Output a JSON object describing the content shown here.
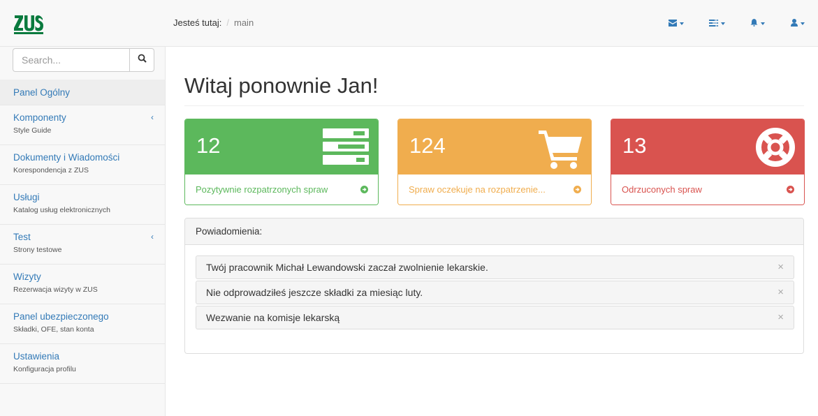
{
  "header": {
    "logo_text": "ZUS",
    "breadcrumb_label": "Jesteś tutaj:",
    "breadcrumb_separator": "/",
    "breadcrumb_current": "main",
    "icons": [
      "envelope-icon",
      "tasks-icon",
      "bell-icon",
      "user-icon"
    ],
    "accent_color": "#337ab7"
  },
  "sidebar": {
    "search_placeholder": "Search...",
    "items": [
      {
        "title": "Panel Ogólny",
        "subtitle": "",
        "expandable": false,
        "active": true
      },
      {
        "title": "Komponenty",
        "subtitle": "Style Guide",
        "expandable": true
      },
      {
        "title": "Dokumenty i Wiadomości",
        "subtitle": "Korespondencja z ZUS",
        "expandable": false
      },
      {
        "title": "Usługi",
        "subtitle": "Katalog usług elektronicznych",
        "expandable": false
      },
      {
        "title": "Test",
        "subtitle": "Strony testowe",
        "expandable": true
      },
      {
        "title": "Wizyty",
        "subtitle": "Rezerwacja wizyty w ZUS",
        "expandable": false
      },
      {
        "title": "Panel ubezpieczonego",
        "subtitle": "Składki, OFE, stan konta",
        "expandable": false
      },
      {
        "title": "Ustawienia",
        "subtitle": "Konfiguracja profilu",
        "expandable": false
      }
    ],
    "arrow_glyph": "‹"
  },
  "main": {
    "title": "Witaj ponownie Jan!",
    "cards": [
      {
        "value": "12",
        "label": "Pozytywnie rozpatrzonych spraw",
        "color": "#5cb85c",
        "icon": "tasks-icon"
      },
      {
        "value": "124",
        "label": "Spraw oczekuje na rozpatrzenie...",
        "color": "#f0ad4e",
        "icon": "shopping-cart-icon"
      },
      {
        "value": "13",
        "label": "Odrzuconych spraw",
        "color": "#d9534f",
        "icon": "life-ring-icon"
      }
    ],
    "notifications": {
      "heading": "Powiadomienia:",
      "items": [
        "Twój pracownik Michał Lewandowski zaczał zwolnienie lekarskie.",
        "Nie odprowadziłeś jeszcze składki za miesiąc luty.",
        "Wezwanie na komisje lekarską"
      ],
      "close_glyph": "×"
    }
  }
}
